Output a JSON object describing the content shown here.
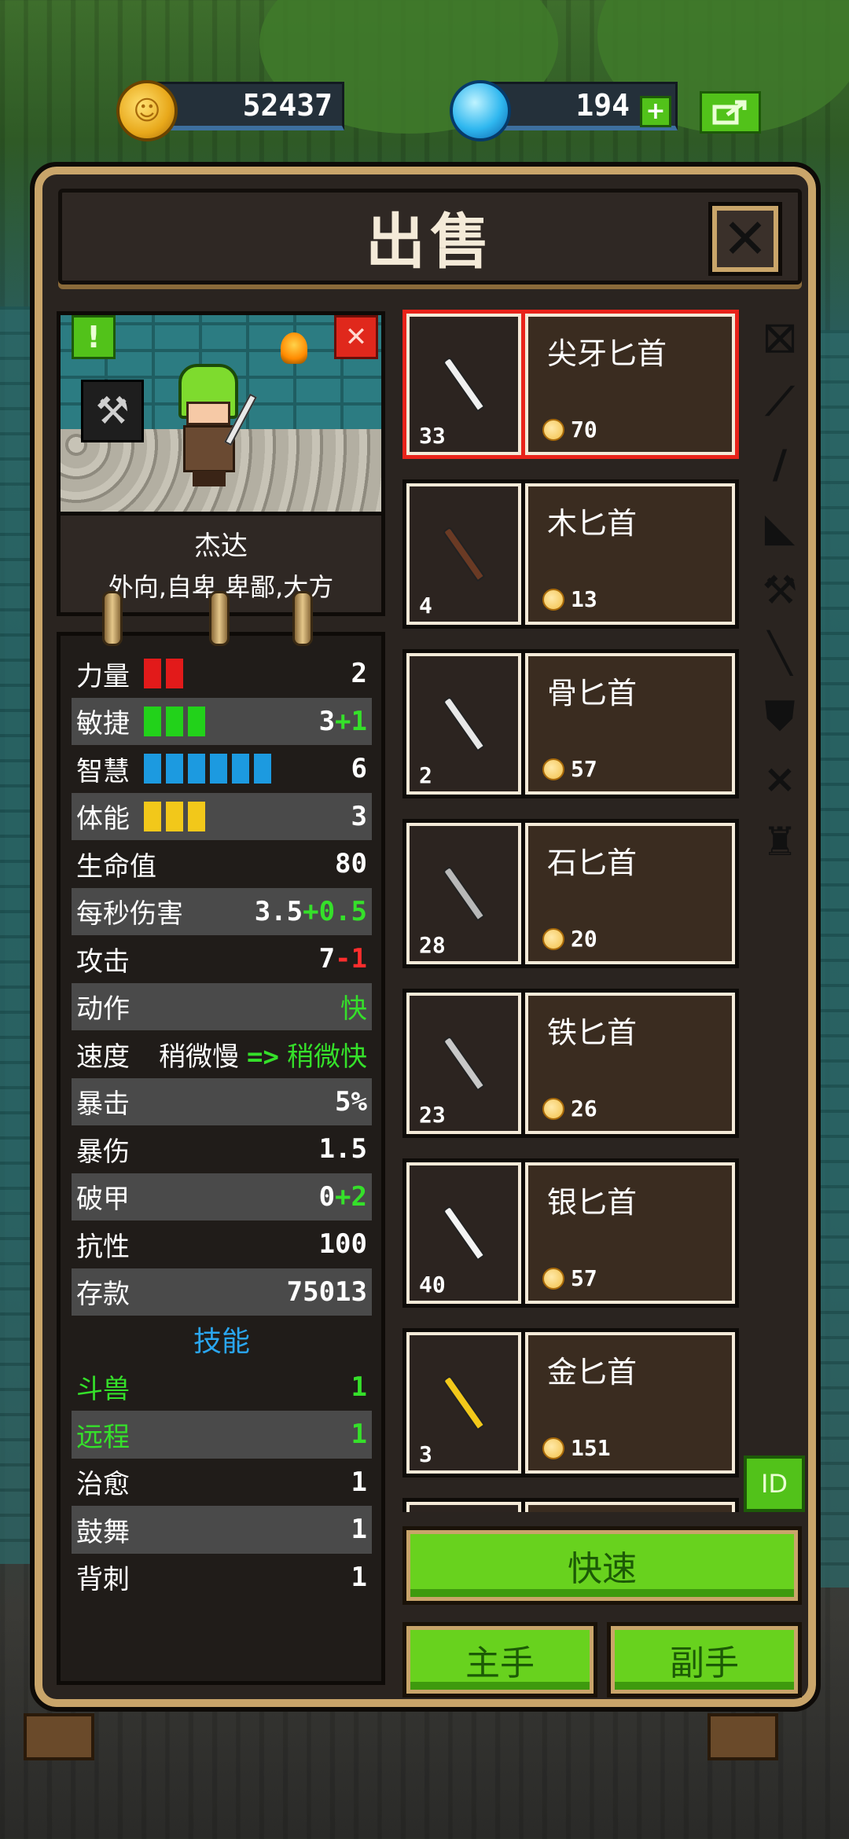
{
  "currency": {
    "coins": "52437",
    "gems": "194",
    "gems_plus": "+",
    "share_icon": "share-icon"
  },
  "dialog": {
    "title": "出售",
    "close": "✕"
  },
  "hero": {
    "name": "杰达",
    "traits": "外向,自卑,卑鄙,大方",
    "excl_label": "!",
    "dismiss_label": "✕",
    "tool_icon": "⚒"
  },
  "stats": {
    "rows": [
      {
        "label": "力量",
        "value": "2",
        "bars": 2,
        "bar_color": "#e21a1a"
      },
      {
        "label": "敏捷",
        "value": "3",
        "bonus": "+1",
        "bonus_type": "green",
        "bars": 3,
        "bar_color": "#22d21a"
      },
      {
        "label": "智慧",
        "value": "6",
        "bars": 6,
        "bar_color": "#1c9ae0"
      },
      {
        "label": "体能",
        "value": "3",
        "bars": 3,
        "bar_color": "#f2c81a"
      },
      {
        "label": "生命值",
        "value": "80"
      },
      {
        "label": "每秒伤害",
        "value": "3.5",
        "bonus": "+0.5",
        "bonus_type": "green"
      },
      {
        "label": "攻击",
        "value": "7",
        "bonus": "-1",
        "bonus_type": "red"
      },
      {
        "label": "动作",
        "value": "快",
        "value_green": true
      },
      {
        "label": "速度",
        "speed_from": "稍微慢",
        "speed_arrow": "=>",
        "speed_to": "稍微快"
      },
      {
        "label": "暴击",
        "value": "5%"
      },
      {
        "label": "暴伤",
        "value": "1.5"
      },
      {
        "label": "破甲",
        "value": "0",
        "bonus": "+2",
        "bonus_type": "green"
      },
      {
        "label": "抗性",
        "value": "100"
      },
      {
        "label": "存款",
        "value": "75013"
      }
    ],
    "skills_title": "技能",
    "skills": [
      {
        "label": "斗兽",
        "value": "1",
        "highlight": true
      },
      {
        "label": "远程",
        "value": "1",
        "highlight": true
      },
      {
        "label": "治愈",
        "value": "1"
      },
      {
        "label": "鼓舞",
        "value": "1"
      },
      {
        "label": "背刺",
        "value": "1"
      }
    ]
  },
  "items": [
    {
      "name": "尖牙匕首",
      "qty": "33",
      "price": "70",
      "selected": true,
      "blade": "#f0f0f0"
    },
    {
      "name": "木匕首",
      "qty": "4",
      "price": "13",
      "blade": "#6a3a24"
    },
    {
      "name": "骨匕首",
      "qty": "2",
      "price": "57",
      "blade": "#e8e8e8"
    },
    {
      "name": "石匕首",
      "qty": "28",
      "price": "20",
      "blade": "#b8b8b8"
    },
    {
      "name": "铁匕首",
      "qty": "23",
      "price": "26",
      "blade": "#c8c8c8"
    },
    {
      "name": "银匕首",
      "qty": "40",
      "price": "57",
      "blade": "#f4f4f4"
    },
    {
      "name": "金匕首",
      "qty": "3",
      "price": "151",
      "blade": "#f2c81a"
    }
  ],
  "categories": [
    {
      "icon": "shield-cross-icon",
      "glyph": "⛝"
    },
    {
      "icon": "blade-icon",
      "glyph": "⟋"
    },
    {
      "icon": "sword-icon",
      "glyph": "/"
    },
    {
      "icon": "boot-icon",
      "glyph": "◣"
    },
    {
      "icon": "axe-icon",
      "glyph": "⚒"
    },
    {
      "icon": "staff-icon",
      "glyph": "╲"
    },
    {
      "icon": "shield-icon",
      "glyph": "⛊"
    },
    {
      "icon": "bow-icon",
      "glyph": "⨯"
    },
    {
      "icon": "helmet-icon",
      "glyph": "♜"
    }
  ],
  "buttons": {
    "id": "ID",
    "quick": "快速",
    "main_hand": "主手",
    "off_hand": "副手"
  }
}
